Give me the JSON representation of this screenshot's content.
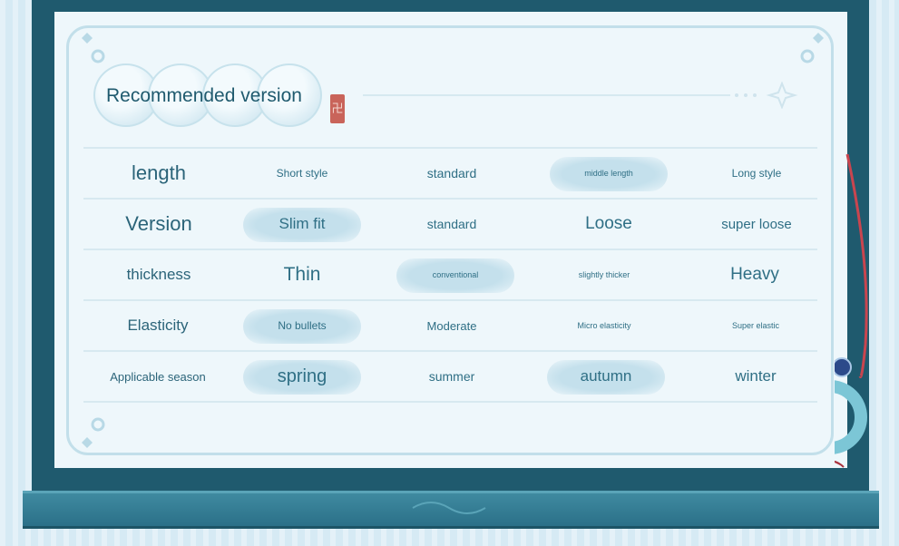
{
  "title": "Recommended version",
  "seal_glyph": "卍",
  "rows": [
    {
      "label": "length",
      "options": [
        "Short style",
        "standard",
        "middle length",
        "Long style"
      ],
      "highlighted": [
        2
      ]
    },
    {
      "label": "Version",
      "options": [
        "Slim fit",
        "standard",
        "Loose",
        "super loose"
      ],
      "highlighted": [
        0
      ]
    },
    {
      "label": "thickness",
      "options": [
        "Thin",
        "conventional",
        "slightly thicker",
        "Heavy"
      ],
      "highlighted": [
        1
      ]
    },
    {
      "label": "Elasticity",
      "options": [
        "No bullets",
        "Moderate",
        "Micro elasticity",
        "Super elastic"
      ],
      "highlighted": [
        0
      ]
    },
    {
      "label": "Applicable season",
      "options": [
        "spring",
        "summer",
        "autumn",
        "winter"
      ],
      "highlighted": [
        0,
        2
      ]
    }
  ],
  "colors": {
    "frame": "#1f5a6e",
    "card": "#eef7fb",
    "highlight": "#c4e0ec",
    "text": "#2f6f85",
    "seal": "#c9645a",
    "ribbon": "#c9454f"
  }
}
